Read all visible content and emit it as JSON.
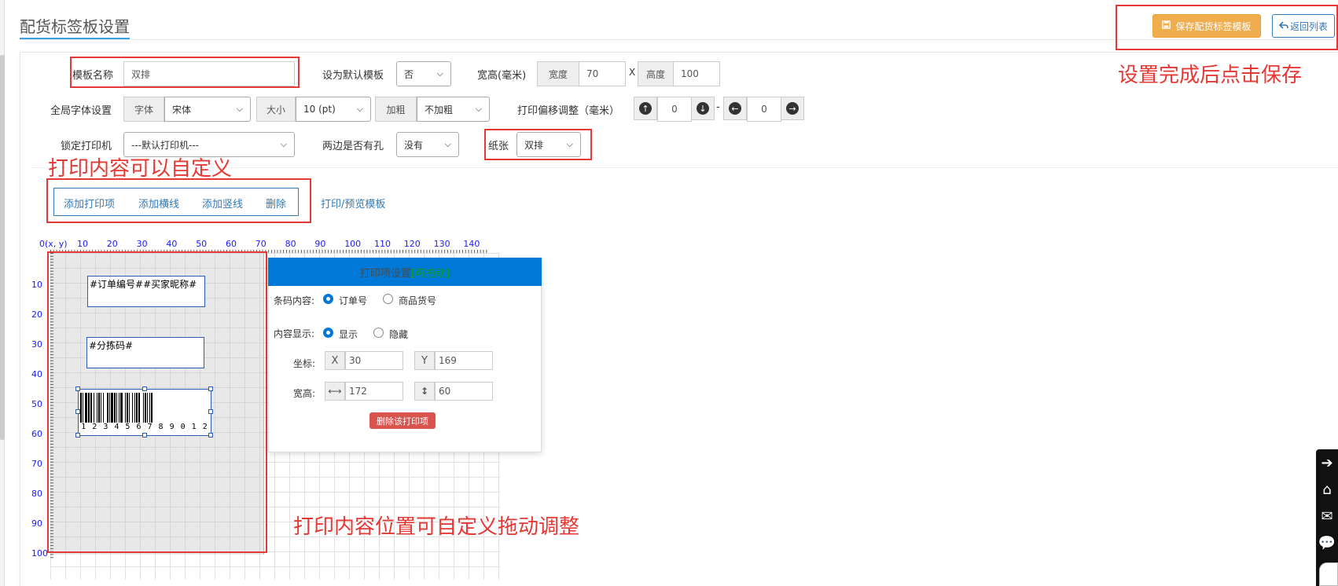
{
  "page": {
    "title": "配货标签板设置"
  },
  "header": {
    "save_label": "保存配货标签模板",
    "back_label": "返回列表"
  },
  "form": {
    "template_name_label": "模板名称",
    "template_name_value": "双排",
    "default_label": "设为默认模板",
    "default_value": "否",
    "size_label": "宽高(毫米)",
    "width_addon": "宽度",
    "width_value": "70",
    "size_sep": "X",
    "height_addon": "高度",
    "height_value": "100",
    "font_label": "全局字体设置",
    "font_addon": "字体",
    "font_value": "宋体",
    "size_addon": "大小",
    "font_size_value": "10 (pt)",
    "bold_addon": "加粗",
    "bold_value": "不加粗",
    "offset_label": "打印偏移调整（毫米）",
    "offset_y_value": "0",
    "offset_sep": "-",
    "offset_x_value": "0",
    "printer_label": "锁定打印机",
    "printer_value": "---默认打印机---",
    "holes_label": "两边是否有孔",
    "holes_value": "没有",
    "paper_label": "纸张",
    "paper_value": "双排"
  },
  "actions": {
    "add_item": "添加打印项",
    "add_hline": "添加横线",
    "add_vline": "添加竖线",
    "delete": "删除",
    "print_preview": "打印/预览模板"
  },
  "annotations": {
    "save_hint": "设置完成后点击保存",
    "custom_hint": "打印内容可以自定义",
    "drag_hint": "打印内容位置可自定义拖动调整"
  },
  "ruler": {
    "origin": "0(x, y)",
    "top": [
      "10",
      "20",
      "30",
      "40",
      "50",
      "60",
      "70",
      "80",
      "90",
      "100",
      "110",
      "120",
      "130",
      "140"
    ],
    "left": [
      "10",
      "20",
      "30",
      "40",
      "50",
      "60",
      "70",
      "80",
      "90",
      "100"
    ]
  },
  "canvas": {
    "item1_text": "#订单编号##买家昵称#",
    "item2_text": "#分拣码#",
    "barcode_digits": "1 2 3 4 5 6 7 8 9 0 1 2"
  },
  "settings": {
    "title": "打印项设置",
    "drag_label": "[可拖动]",
    "barcode_label": "条码内容:",
    "opt_order": "订单号",
    "opt_sku": "商品货号",
    "display_label": "内容显示:",
    "opt_show": "显示",
    "opt_hide": "隐藏",
    "coord_label": "坐标:",
    "x_addon": "X",
    "x_value": "30",
    "y_addon": "Y",
    "y_value": "169",
    "size_label": "宽高:",
    "w_value": "172",
    "h_value": "60",
    "delete_label": "删除该打印项"
  },
  "colors": {
    "accent": "#337ab7",
    "warning": "#f0ad4e",
    "annotation": "#e53935",
    "panel_header": "#0078d7",
    "danger": "#d9534f"
  }
}
